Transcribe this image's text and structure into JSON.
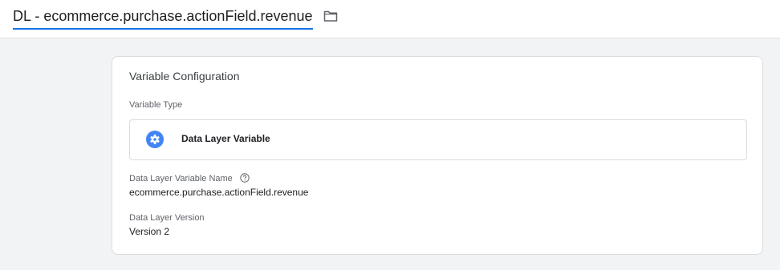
{
  "header": {
    "title": "DL - ecommerce.purchase.actionField.revenue",
    "folder_icon": "folder-icon"
  },
  "config": {
    "card_title": "Variable Configuration",
    "variable_type_label": "Variable Type",
    "variable_type_name": "Data Layer Variable",
    "variable_type_icon": "gear-icon",
    "name_label": "Data Layer Variable Name",
    "name_help_icon": "help-icon",
    "name_value": "ecommerce.purchase.actionField.revenue",
    "version_label": "Data Layer Version",
    "version_value": "Version 2"
  },
  "colors": {
    "accent": "#1a73e8",
    "background": "#f1f3f4",
    "card": "#ffffff",
    "border": "#dadce0"
  }
}
